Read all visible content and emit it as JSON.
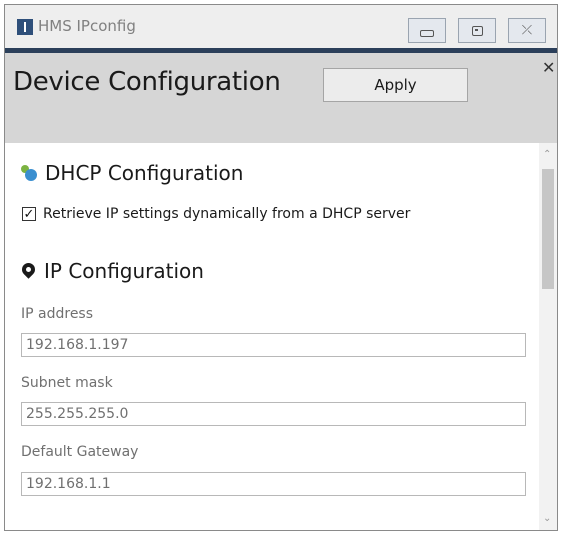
{
  "window": {
    "title": "HMS IPconfig",
    "icons": {
      "app": "app-logo-icon",
      "minimize": "minimize-icon",
      "maximize": "maximize-icon",
      "close": "close-icon"
    },
    "close_glyph": "⤫"
  },
  "header": {
    "title": "Device Configuration",
    "apply_label": "Apply",
    "dismiss_glyph": "✕"
  },
  "dhcp": {
    "heading": "DHCP Configuration",
    "icon": "network-globe-icon",
    "checkbox_label": "Retrieve IP settings dynamically from a DHCP server",
    "checkbox_checked": true,
    "check_glyph": "✓"
  },
  "ip": {
    "heading": "IP Configuration",
    "icon": "location-pin-icon",
    "fields": [
      {
        "label": "IP address",
        "value": "192.168.1.197"
      },
      {
        "label": "Subnet mask",
        "value": "255.255.255.0"
      },
      {
        "label": "Default Gateway",
        "value": "192.168.1.1"
      }
    ]
  },
  "scrollbar": {
    "up_glyph": "⌃",
    "down_glyph": "⌄"
  },
  "colors": {
    "titlebar_accent": "#2b3f5a",
    "header_bg": "#d6d6d6",
    "app_icon": "#2e4f7a"
  }
}
